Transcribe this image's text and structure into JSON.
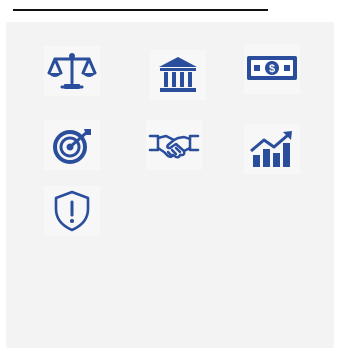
{
  "accent_color": "#2a4e9c",
  "icons": [
    {
      "name": "balance-scale-icon"
    },
    {
      "name": "bank-icon"
    },
    {
      "name": "money-bill-icon"
    },
    {
      "name": "target-icon"
    },
    {
      "name": "handshake-icon"
    },
    {
      "name": "growth-chart-icon"
    },
    {
      "name": "shield-alert-icon"
    }
  ]
}
